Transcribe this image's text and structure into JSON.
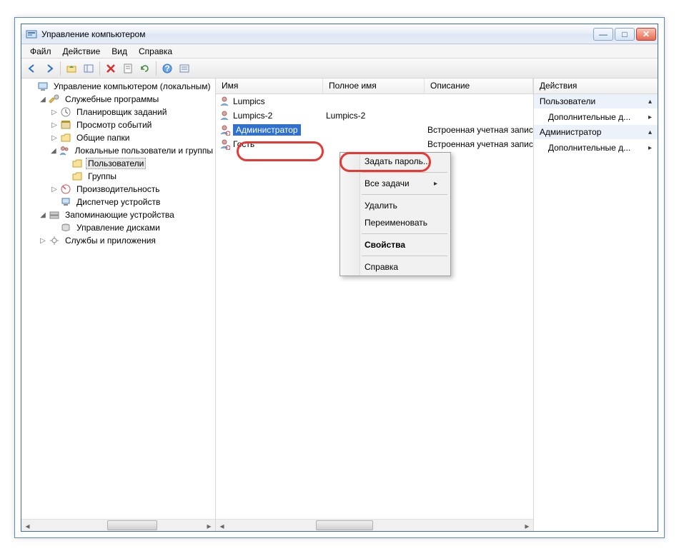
{
  "window": {
    "title": "Управление компьютером"
  },
  "winbtns": {
    "min": "—",
    "max": "□",
    "close": "✕"
  },
  "menubar": {
    "file": "Файл",
    "action": "Действие",
    "view": "Вид",
    "help": "Справка"
  },
  "tree": {
    "root": "Управление компьютером (локальным)",
    "utilities": "Служебные программы",
    "scheduler": "Планировщик заданий",
    "eventviewer": "Просмотр событий",
    "sharedfolders": "Общие папки",
    "localusers": "Локальные пользователи и группы",
    "users": "Пользователи",
    "groups": "Группы",
    "performance": "Производительность",
    "devmgr": "Диспетчер устройств",
    "storage": "Запоминающие устройства",
    "diskmgmt": "Управление дисками",
    "services": "Службы и приложения"
  },
  "list": {
    "headers": {
      "name": "Имя",
      "fullname": "Полное имя",
      "description": "Описание"
    },
    "rows": [
      {
        "name": "Lumpics",
        "fullname": "",
        "description": ""
      },
      {
        "name": "Lumpics-2",
        "fullname": "Lumpics-2",
        "description": ""
      },
      {
        "name": "Администратор",
        "fullname": "",
        "description": "Встроенная учетная запис"
      },
      {
        "name": "Гость",
        "fullname": "",
        "description": "Встроенная учетная запис"
      }
    ]
  },
  "contextmenu": {
    "setpassword": "Задать пароль...",
    "alltasks": "Все задачи",
    "delete": "Удалить",
    "rename": "Переименовать",
    "properties": "Свойства",
    "help": "Справка"
  },
  "actions": {
    "title": "Действия",
    "section1": "Пользователи",
    "more1": "Дополнительные д...",
    "section2": "Администратор",
    "more2": "Дополнительные д..."
  }
}
